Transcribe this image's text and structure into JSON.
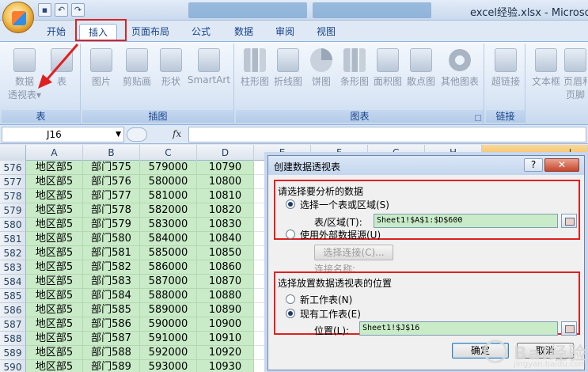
{
  "window": {
    "title": "excel经验.xlsx - Microsoft"
  },
  "ribbon_tabs": [
    "开始",
    "插入",
    "页面布局",
    "公式",
    "数据",
    "审阅",
    "视图"
  ],
  "active_tab": "插入",
  "ribbon": {
    "pivot_label_1": "数据",
    "pivot_label_2": "透视表",
    "pivot_dropdown": "▾",
    "table_label": "表",
    "group_tables": "表",
    "picture": "图片",
    "clipart": "剪贴画",
    "shapes": "形状",
    "smartart": "SmartArt",
    "group_illustrations": "插图",
    "column_chart": "柱形图",
    "line_chart": "折线图",
    "pie_chart": "饼图",
    "bar_chart": "条形图",
    "area_chart": "面积图",
    "scatter_chart": "散点图",
    "other_charts": "其他图表",
    "group_charts": "图表",
    "hyperlink": "超链接",
    "group_links": "链接",
    "textbox": "文本框",
    "header_footer_1": "页眉和",
    "header_footer_2": "页脚"
  },
  "formula_bar": {
    "name_box": "J16",
    "fx": "fx"
  },
  "columns": [
    "A",
    "B",
    "C",
    "D",
    "E",
    "F",
    "G",
    "H",
    "I"
  ],
  "rows": [
    {
      "num": "576",
      "a": "地区部5",
      "b": "部门575",
      "c": "579000",
      "d": "10790"
    },
    {
      "num": "577",
      "a": "地区部5",
      "b": "部门576",
      "c": "580000",
      "d": "10800"
    },
    {
      "num": "578",
      "a": "地区部5",
      "b": "部门577",
      "c": "581000",
      "d": "10810"
    },
    {
      "num": "579",
      "a": "地区部5",
      "b": "部门578",
      "c": "582000",
      "d": "10820"
    },
    {
      "num": "580",
      "a": "地区部5",
      "b": "部门579",
      "c": "583000",
      "d": "10830"
    },
    {
      "num": "581",
      "a": "地区部5",
      "b": "部门580",
      "c": "584000",
      "d": "10840"
    },
    {
      "num": "582",
      "a": "地区部5",
      "b": "部门581",
      "c": "585000",
      "d": "10850"
    },
    {
      "num": "583",
      "a": "地区部5",
      "b": "部门582",
      "c": "586000",
      "d": "10860"
    },
    {
      "num": "584",
      "a": "地区部5",
      "b": "部门583",
      "c": "587000",
      "d": "10870"
    },
    {
      "num": "585",
      "a": "地区部5",
      "b": "部门584",
      "c": "588000",
      "d": "10880"
    },
    {
      "num": "586",
      "a": "地区部5",
      "b": "部门585",
      "c": "589000",
      "d": "10890"
    },
    {
      "num": "587",
      "a": "地区部5",
      "b": "部门586",
      "c": "590000",
      "d": "10900"
    },
    {
      "num": "588",
      "a": "地区部5",
      "b": "部门587",
      "c": "591000",
      "d": "10910"
    },
    {
      "num": "589",
      "a": "地区部5",
      "b": "部门588",
      "c": "592000",
      "d": "10920"
    },
    {
      "num": "590",
      "a": "地区部5",
      "b": "部门589",
      "c": "593000",
      "d": "10930"
    }
  ],
  "dialog": {
    "title": "创建数据透视表",
    "help": "?",
    "close": "✕",
    "section1_title": "请选择要分析的数据",
    "option_select_range": "选择一个表或区域(S)",
    "range_label": "表/区域(T):",
    "range_value": "Sheet1!$A$1:$D$600",
    "option_external": "使用外部数据源(U)",
    "choose_connection": "选择连接(C)...",
    "connection_name": "连接名称:",
    "section2_title": "选择放置数据透视表的位置",
    "option_new_sheet": "新工作表(N)",
    "option_existing_sheet": "现有工作表(E)",
    "location_label": "位置(L):",
    "location_value": "Sheet1!$J$16",
    "ok": "确定",
    "cancel": "取消"
  },
  "watermark": {
    "text": "Bai经验",
    "sub": "jingyan.baidu.com"
  }
}
